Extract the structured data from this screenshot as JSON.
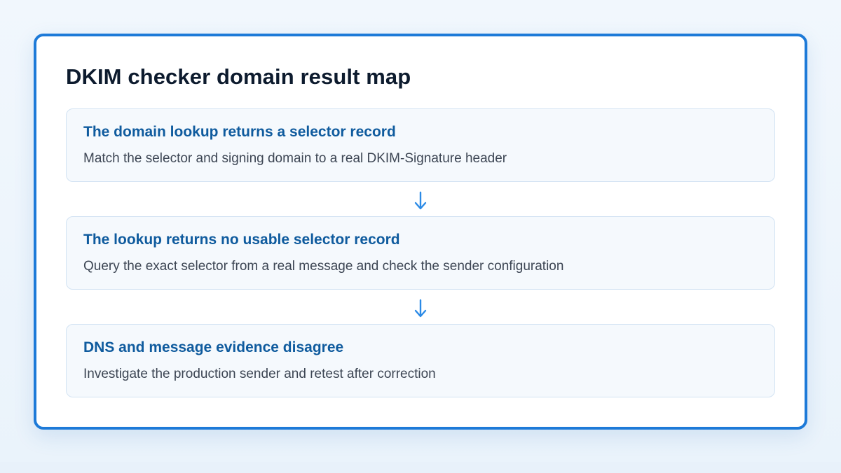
{
  "title": "DKIM checker domain result map",
  "steps": [
    {
      "heading": "The domain lookup returns a selector record",
      "text": "Match the selector and signing domain to a real DKIM-Signature header"
    },
    {
      "heading": "The lookup returns no usable selector record",
      "text": "Query the exact selector from a real message and check the sender configuration"
    },
    {
      "heading": "DNS and message evidence disagree",
      "text": "Investigate the production sender and retest after correction"
    }
  ],
  "colors": {
    "accent": "#1d7ad8",
    "heading": "#0f5b9e",
    "title": "#0d1b2e",
    "body_text": "#3d4654",
    "step_background": "#f5f9fd",
    "step_border": "#d3e3f3",
    "arrow": "#2b8ae6"
  },
  "connectors": [
    {
      "icon": "arrow-down-icon"
    },
    {
      "icon": "arrow-down-icon"
    }
  ]
}
